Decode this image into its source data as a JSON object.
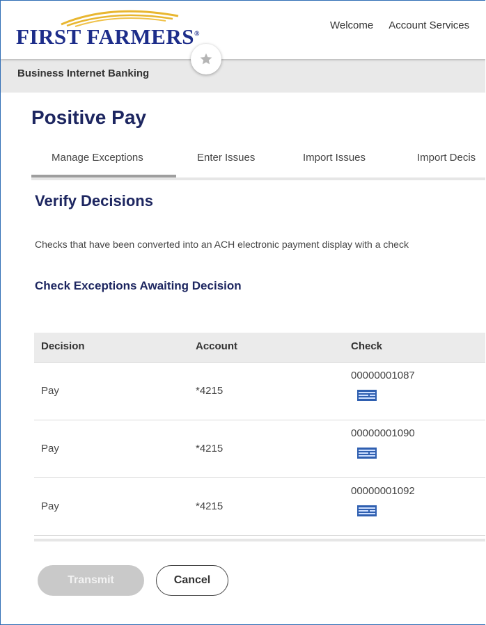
{
  "header": {
    "logo_text": "FIRST FARMERS",
    "logo_mark": "®",
    "nav": [
      "Welcome",
      "Account Services"
    ],
    "app_name": "Business Internet Banking"
  },
  "page": {
    "title": "Positive Pay",
    "tabs": [
      "Manage Exceptions",
      "Enter Issues",
      "Import Issues",
      "Import Decis"
    ],
    "active_tab": "Manage Exceptions",
    "section_title": "Verify Decisions",
    "description": "Checks that have been converted into an ACH electronic payment display with a check",
    "subsection_title": "Check Exceptions Awaiting Decision"
  },
  "table": {
    "columns": [
      "Decision",
      "Account",
      "Check"
    ],
    "rows": [
      {
        "decision": "Pay",
        "account": "*4215",
        "check": "00000001087"
      },
      {
        "decision": "Pay",
        "account": "*4215",
        "check": "00000001090"
      },
      {
        "decision": "Pay",
        "account": "*4215",
        "check": "00000001092"
      }
    ]
  },
  "actions": {
    "transmit_label": "Transmit",
    "cancel_label": "Cancel"
  },
  "colors": {
    "brand_navy": "#1d2660",
    "logo_blue": "#1d2d8a",
    "logo_gold": "#e8b630",
    "check_icon_blue": "#2f5fb0"
  }
}
